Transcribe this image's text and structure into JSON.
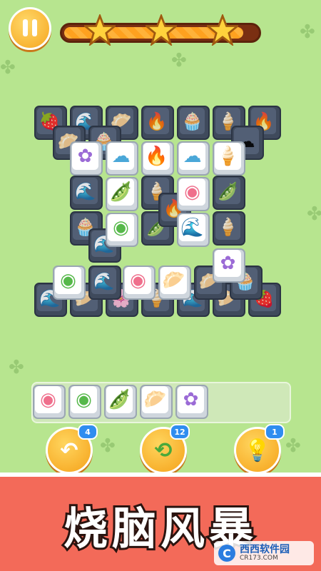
{
  "colors": {
    "background": "#b7e58f",
    "banner": "#f36a59",
    "button": "#f6a51e",
    "badge": "#2f8df0"
  },
  "level_progress": {
    "value_fraction": 0.93,
    "stars": 3
  },
  "tile_icons": {
    "flower": "flower-icon",
    "cotton": "cotton-icon",
    "fire": "campfire-icon",
    "icecream": "ice-cream-cone-icon",
    "peas": "pea-pod-icon",
    "roll": "swiss-roll-icon",
    "wave": "wave-icon",
    "zongzi": "rice-dumpling-icon"
  },
  "tray": {
    "items": [
      "roll-pink",
      "roll-green",
      "peas",
      "zongzi",
      "flower"
    ]
  },
  "powerups": {
    "undo": {
      "count": "4",
      "icon": "undo-icon"
    },
    "shuffle": {
      "count": "12",
      "icon": "shuffle-icon"
    },
    "hint": {
      "count": "1",
      "icon": "lightbulb-icon"
    }
  },
  "banner": {
    "title": "烧脑风暴"
  },
  "watermark": {
    "name": "西西软件园",
    "site": "CR173.COM"
  }
}
